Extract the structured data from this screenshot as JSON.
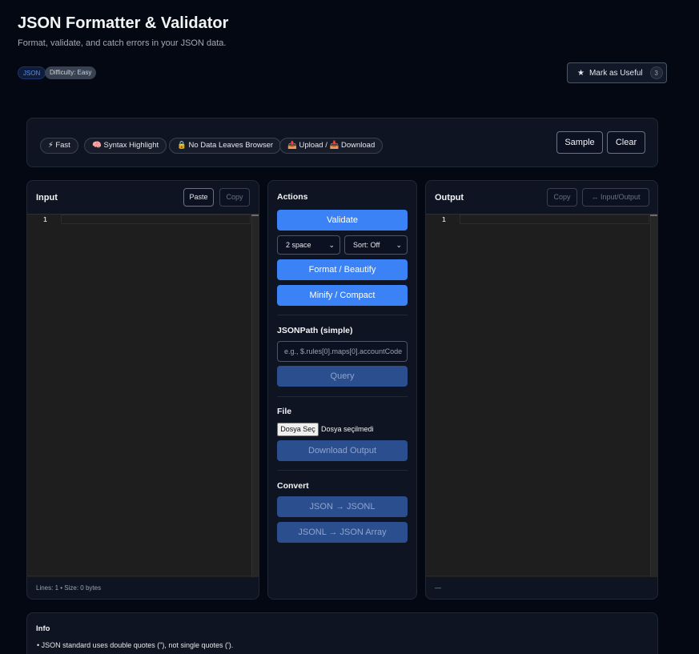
{
  "page": {
    "title": "JSON Formatter & Validator",
    "subtitle": "Format, validate, and catch errors in your JSON data.",
    "tags": [
      "JSON",
      "Difficulty: Easy"
    ],
    "useful_label": "Mark as Useful",
    "useful_count": "3"
  },
  "toolbar": {
    "chips": [
      {
        "icon": "⚡",
        "label": "Fast"
      },
      {
        "icon": "🧠",
        "label": "Syntax Highlight"
      },
      {
        "icon": "🔒",
        "label": "No Data Leaves Browser"
      },
      {
        "icon": "📤",
        "label": "Upload /"
      },
      {
        "icon": "📥",
        "label": "Download"
      }
    ],
    "sample_label": "Sample",
    "clear_label": "Clear"
  },
  "input": {
    "title": "Input",
    "paste_label": "Paste",
    "copy_label": "Copy",
    "line_number": "1",
    "status": "Lines: 1 • Size: 0 bytes"
  },
  "actions": {
    "title": "Actions",
    "validate_label": "Validate",
    "indent_value": "2 space",
    "sort_value": "Sort: Off",
    "format_label": "Format / Beautify",
    "minify_label": "Minify / Compact",
    "jsonpath_title": "JSONPath (simple)",
    "jsonpath_placeholder": "e.g., $.rules[0].maps[0].accountCode",
    "query_label": "Query",
    "file_title": "File",
    "file_button": "Dosya Seç",
    "file_status": "Dosya seçilmedi",
    "download_label": "Download Output",
    "convert_title": "Convert",
    "to_jsonl_label": "JSON → JSONL",
    "to_array_label": "JSONL → JSON Array"
  },
  "output": {
    "title": "Output",
    "copy_label": "Copy",
    "swap_label": "↔ Input/Output",
    "line_number": "1",
    "status": "—"
  },
  "info": {
    "title": "Info",
    "items": [
      "JSON standard uses double quotes (\"), not single quotes (')."
    ]
  },
  "colors": {
    "background": "#040812",
    "panel": "#0e1422",
    "primary": "#3b82f6",
    "primary_disabled": "#2b4f8e",
    "editor": "#1e1e1e"
  }
}
